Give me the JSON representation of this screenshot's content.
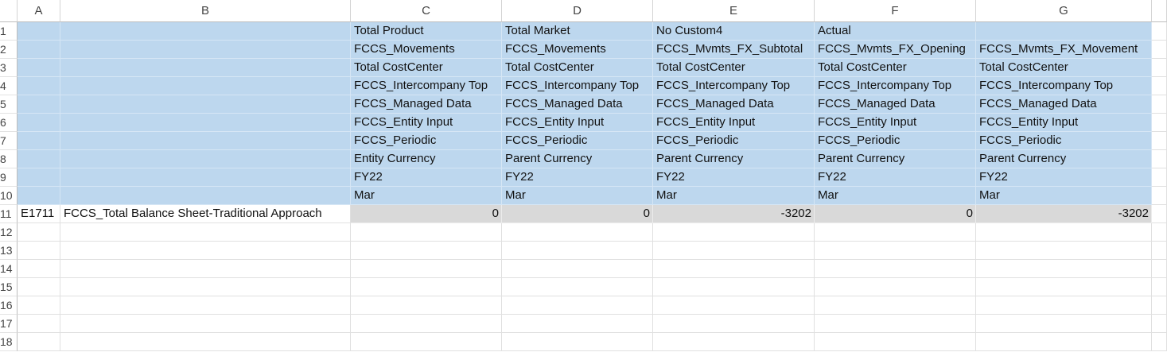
{
  "columns": [
    "A",
    "B",
    "C",
    "D",
    "E",
    "F",
    "G"
  ],
  "row_numbers": [
    "1",
    "2",
    "3",
    "4",
    "5",
    "6",
    "7",
    "8",
    "9",
    "10",
    "11",
    "12",
    "13",
    "14",
    "15",
    "16",
    "17",
    "18"
  ],
  "header_rows": [
    [
      "",
      "",
      "Total Product",
      "Total Market",
      "No Custom4",
      "Actual",
      ""
    ],
    [
      "",
      "",
      "FCCS_Movements",
      "FCCS_Movements",
      "FCCS_Mvmts_FX_Subtotal",
      "FCCS_Mvmts_FX_Opening",
      "FCCS_Mvmts_FX_Movement"
    ],
    [
      "",
      "",
      "Total CostCenter",
      "Total CostCenter",
      "Total CostCenter",
      "Total CostCenter",
      "Total CostCenter"
    ],
    [
      "",
      "",
      "FCCS_Intercompany Top",
      "FCCS_Intercompany Top",
      "FCCS_Intercompany Top",
      "FCCS_Intercompany Top",
      "FCCS_Intercompany Top"
    ],
    [
      "",
      "",
      "FCCS_Managed Data",
      "FCCS_Managed Data",
      "FCCS_Managed Data",
      "FCCS_Managed Data",
      "FCCS_Managed Data"
    ],
    [
      "",
      "",
      "FCCS_Entity Input",
      "FCCS_Entity Input",
      "FCCS_Entity Input",
      "FCCS_Entity Input",
      "FCCS_Entity Input"
    ],
    [
      "",
      "",
      "FCCS_Periodic",
      "FCCS_Periodic",
      "FCCS_Periodic",
      "FCCS_Periodic",
      "FCCS_Periodic"
    ],
    [
      "",
      "",
      "Entity Currency",
      "Parent Currency",
      "Parent Currency",
      "Parent Currency",
      "Parent Currency"
    ],
    [
      "",
      "",
      "FY22",
      "FY22",
      "FY22",
      "FY22",
      "FY22"
    ],
    [
      "",
      "",
      "Mar",
      "Mar",
      "Mar",
      "Mar",
      "Mar"
    ]
  ],
  "data_row": [
    "E1711",
    "FCCS_Total Balance Sheet-Traditional Approach",
    "0",
    "0",
    "-3202",
    "0",
    "-3202"
  ],
  "colors": {
    "header_fill": "#bdd7ee",
    "data_fill": "#d9d9d9",
    "gridline": "#e0e0e0"
  }
}
